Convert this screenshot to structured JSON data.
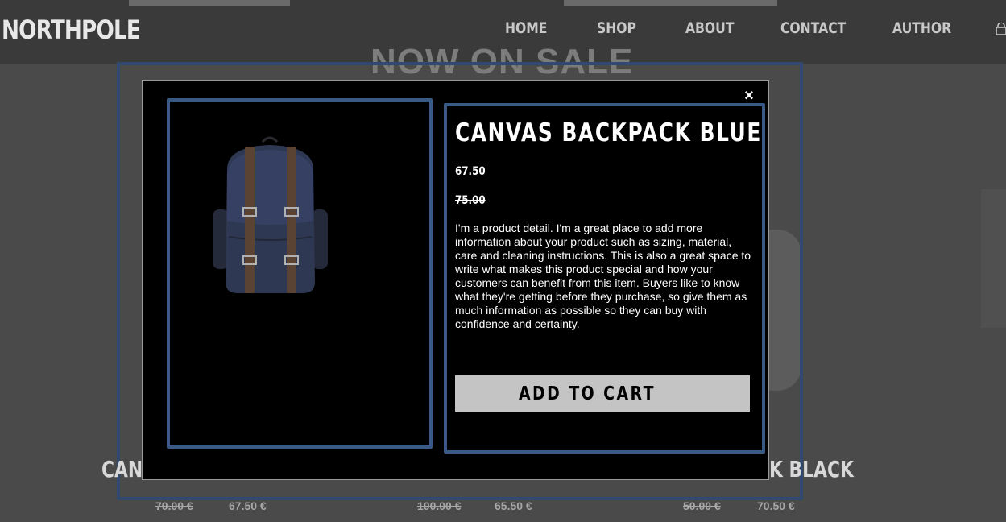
{
  "header": {
    "logo": "NORTHPOLE",
    "nav": [
      "HOME",
      "SHOP",
      "ABOUT",
      "CONTACT",
      "AUTHOR"
    ]
  },
  "sale_section": {
    "title": "NOW ON SALE"
  },
  "background_products": [
    {
      "title_fragment": "CANV",
      "old_price": "70.00 €",
      "price": "67.50 €"
    },
    {
      "title_fragment": "",
      "old_price": "100.00 €",
      "price": "65.50 €"
    },
    {
      "title_fragment": "K BLACK",
      "old_price": "50.00 €",
      "price": "70.50 €"
    }
  ],
  "modal": {
    "close_label": "×",
    "product_title": "CANVAS BACKPACK BLUE",
    "price": "67.50",
    "old_price": "75.00",
    "description": "I'm a product detail. I'm a great place to add more information about your product such as sizing, material, care and cleaning instructions. This is also a great space to write what makes this product special and how your customers can benefit from this item. Buyers like to know what they're getting before they purchase, so give them as much information as possible so they can buy with confidence and certainty.",
    "add_to_cart_label": "ADD TO CART"
  },
  "colors": {
    "frame_blue": "#3a5a86",
    "modal_bg": "#000000",
    "button_bg": "#c4c4c4"
  }
}
